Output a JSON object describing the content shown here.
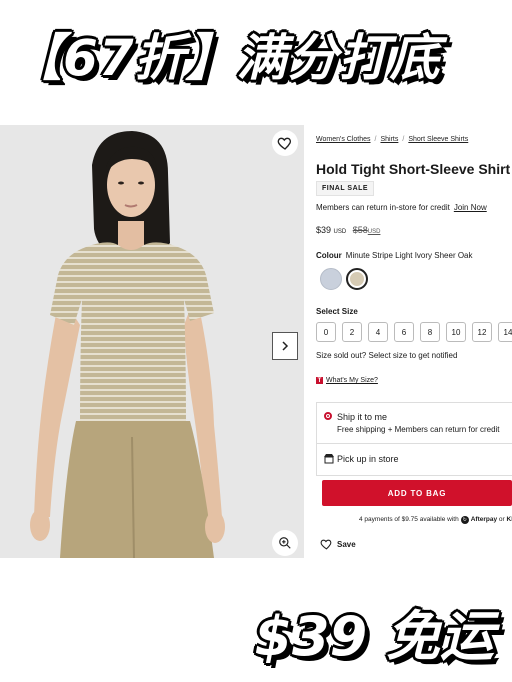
{
  "banner_top": "【67折】满分打底",
  "banner_bottom": "$39 免运",
  "breadcrumb": {
    "items": [
      "Women's Clothes",
      "Shirts",
      "Short Sleeve Shirts"
    ],
    "separator": "/"
  },
  "product": {
    "title": "Hold Tight Short-Sleeve Shirt",
    "badge": "FINAL SALE",
    "members_text": "Members can return in-store for credit",
    "join_label": "Join Now",
    "price": "$39",
    "price_currency": "USD",
    "old_price": "$58",
    "old_currency": "USD",
    "colour_label": "Colour",
    "colour_value": "Minute Stripe Light Ivory Sheer Oak",
    "swatches": [
      "#c9d0dc",
      "#d6cbb4"
    ],
    "size_label": "Select Size",
    "sizes": [
      "0",
      "2",
      "4",
      "6",
      "8",
      "10",
      "12",
      "14"
    ],
    "soldout_text": "Size sold out? Select size to get notified",
    "whatsize_label": "What's My Size?"
  },
  "shipping": {
    "ship_title": "Ship it to me",
    "ship_sub": "Free shipping + Members can return for credit",
    "pickup_title": "Pick up in store"
  },
  "cta": {
    "add_to_bag": "ADD TO BAG"
  },
  "afterpay": {
    "text": "4 payments of $9.75 available with",
    "brand1": "Afterpay",
    "or": "or",
    "brand2": "Kl"
  },
  "save_label": "Save",
  "colors": {
    "accent": "#d0112b",
    "shirt": "#c7bb9c",
    "pants": "#b8a67e",
    "skin": "#e6c3a8",
    "hair": "#1d1a17",
    "photo_bg": "#e7e7e7"
  },
  "icons": {
    "favorite": "heart-icon",
    "next": "chevron-right-icon",
    "zoom": "zoom-in-icon",
    "store": "store-icon"
  }
}
